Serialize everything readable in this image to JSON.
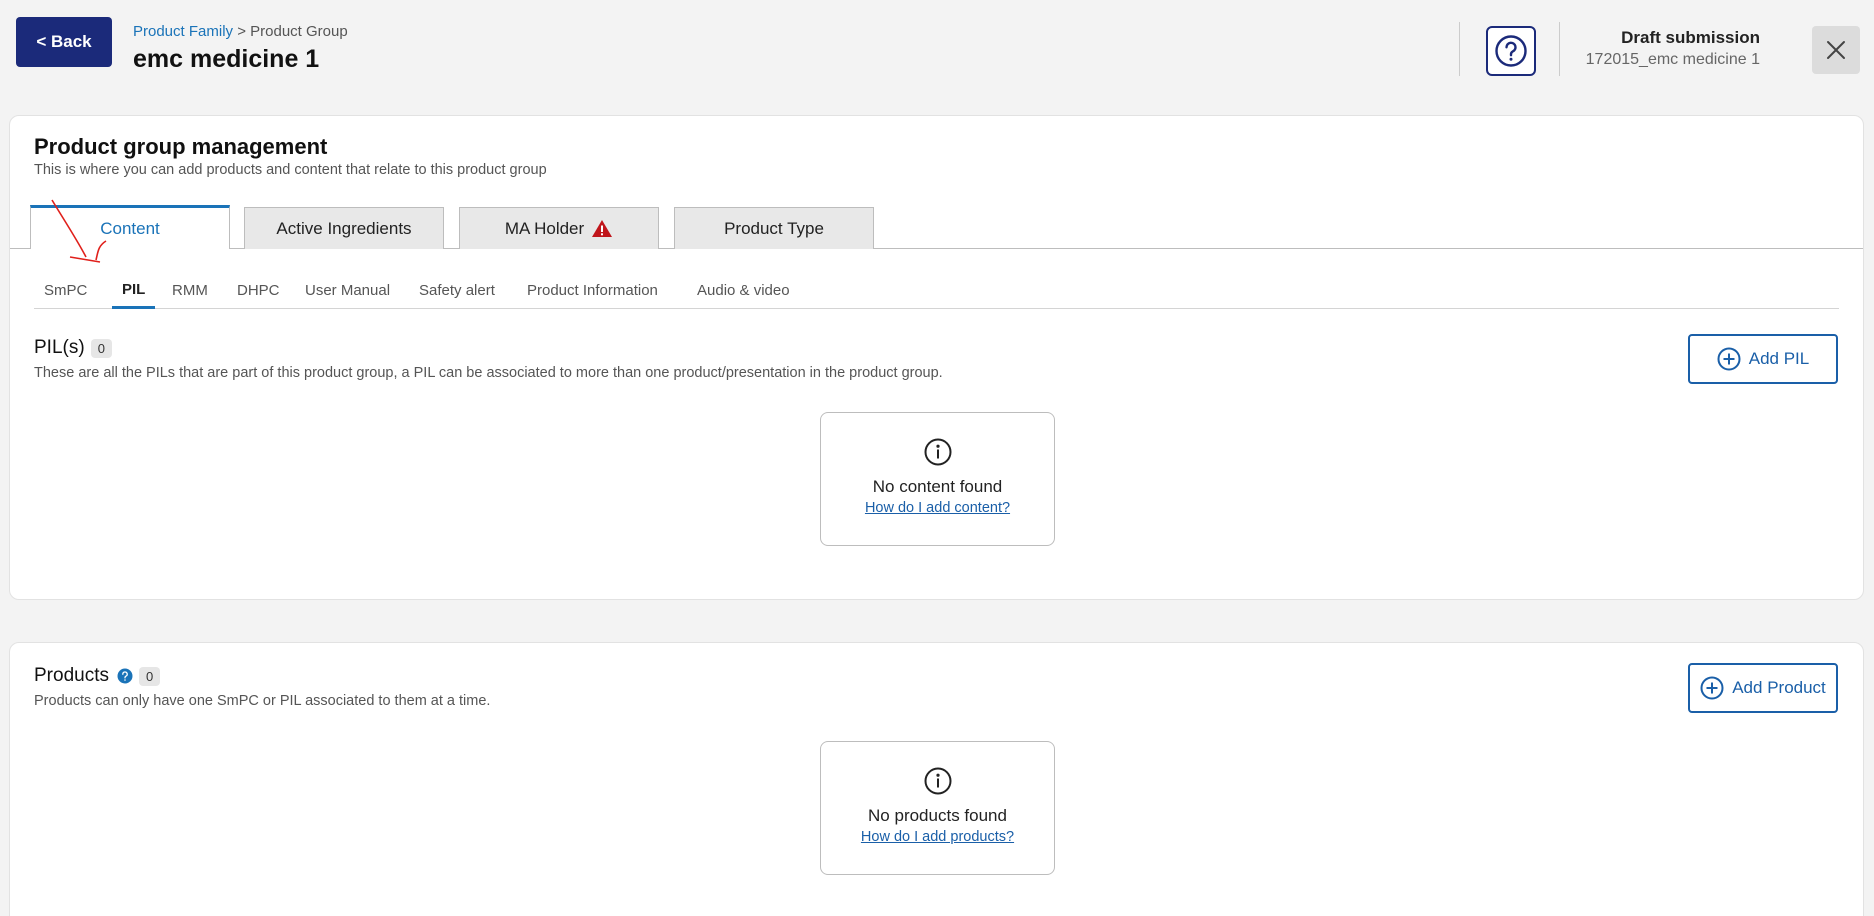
{
  "header": {
    "back_label": "< Back",
    "breadcrumb": {
      "link": "Product Family",
      "sep": " > ",
      "current": "Product Group"
    },
    "title": "emc medicine 1",
    "draft_title": "Draft submission",
    "draft_sub": "172015_emc medicine 1"
  },
  "management": {
    "title": "Product group management",
    "subtitle": "This is where you can add products and content that relate to this product group",
    "tabs": [
      "Content",
      "Active Ingredients",
      "MA Holder",
      "Product Type"
    ],
    "subtabs": [
      "SmPC",
      "PIL",
      "RMM",
      "DHPC",
      "User Manual",
      "Safety alert",
      "Product Information",
      "Audio & video"
    ],
    "active_subtab": "PIL"
  },
  "pils": {
    "title": "PIL(s)",
    "count": "0",
    "subtitle": "These are all the PILs that are part of this product group, a PIL can be associated to more than one product/presentation in the product group.",
    "add_label": "Add PIL",
    "empty_title": "No content found",
    "empty_link": "How do I add content?"
  },
  "products": {
    "title": "Products",
    "count": "0",
    "subtitle": "Products can only have one SmPC or PIL associated to them at a time.",
    "add_label": "Add Product",
    "empty_title": "No products found",
    "empty_link": "How do I add products?"
  },
  "colors": {
    "navy": "#1b2a7a",
    "accent": "#1a73b8",
    "warning": "#c0151b",
    "annotation": "#e0201b"
  },
  "icons": [
    "help-icon",
    "close-icon",
    "warning-icon",
    "add-circle-icon",
    "info-icon",
    "question-dot-icon"
  ]
}
